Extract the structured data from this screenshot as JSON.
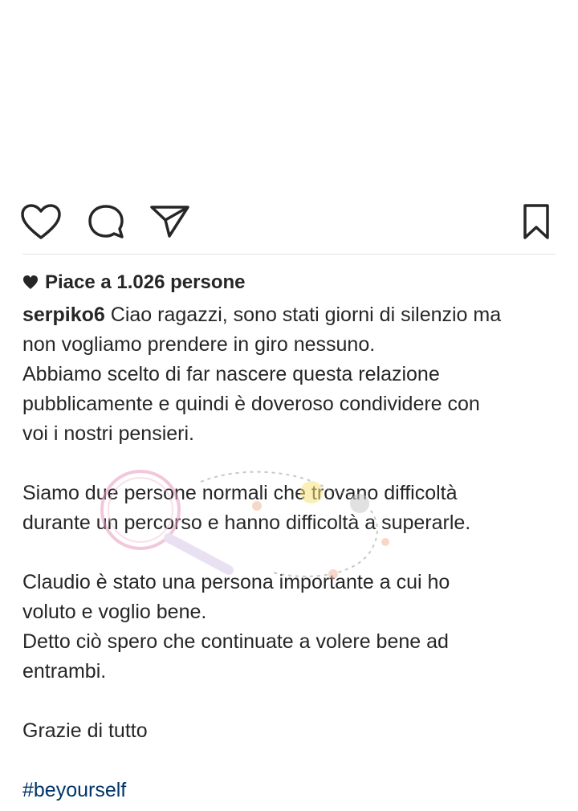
{
  "post": {
    "likes_text": "Piace a 1.026 persone",
    "username": "serpiko6",
    "caption_lines": [
      "Ciao ragazzi, sono stati giorni di silenzio ma",
      "non vogliamo prendere in giro nessuno.",
      "Abbiamo scelto di far nascere questa relazione",
      "pubblicamente e quindi è doveroso  condividere con",
      "voi i nostri pensieri.",
      "",
      "Siamo due persone normali che trovano difficoltà",
      "durante un percorso e hanno difficoltà a superarle.",
      "",
      "Claudio è stato una persona importante a cui ho",
      "voluto e voglio bene.",
      "Detto ciò spero che continuate a volere bene ad",
      "entrambi.",
      "",
      "Grazie di tutto",
      ""
    ],
    "hashtag": "#beyourself"
  },
  "icons": {
    "like": "heart-outline-icon",
    "comment": "comment-bubble-icon",
    "share": "paper-plane-icon",
    "save": "bookmark-icon",
    "likes_heart": "heart-filled-icon"
  },
  "colors": {
    "text": "#262626",
    "hashtag": "#003569",
    "divider": "#e0e0e0"
  }
}
